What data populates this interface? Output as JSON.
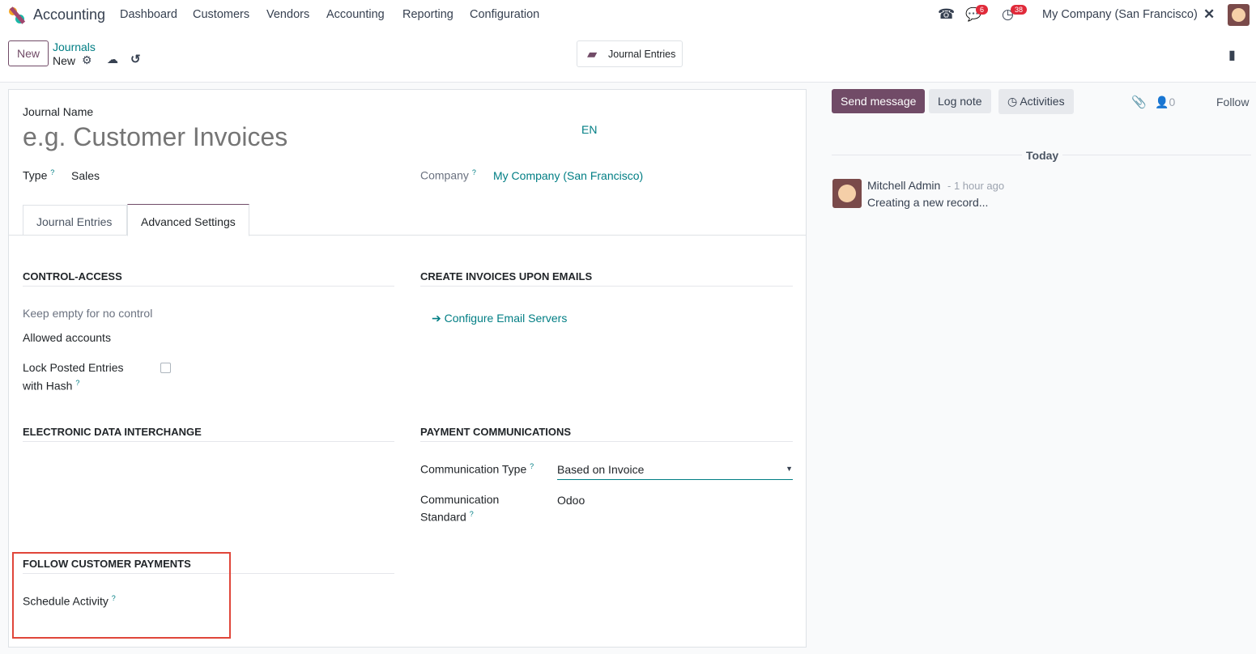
{
  "nav": {
    "app": "Accounting",
    "menu": [
      "Dashboard",
      "Customers",
      "Vendors",
      "Accounting",
      "Reporting",
      "Configuration"
    ],
    "msg_count": "6",
    "activity_count": "38",
    "company": "My Company (San Francisco)"
  },
  "control": {
    "new": "New",
    "breadcrumb": "Journals",
    "record": "New",
    "smart_button": "Journal Entries"
  },
  "form": {
    "journal_name_label": "Journal Name",
    "journal_name_placeholder": "e.g. Customer Invoices",
    "lang": "EN",
    "type_label": "Type",
    "type_value": "Sales",
    "company_label": "Company",
    "company_value": "My Company (San Francisco)",
    "tabs": [
      "Journal Entries",
      "Advanced Settings"
    ],
    "control_access": "CONTROL-ACCESS",
    "keep_empty": "Keep empty for no control",
    "allowed_accounts": "Allowed accounts",
    "lock_posted_1": "Lock Posted Entries",
    "lock_posted_2": "with Hash",
    "create_invoices": "CREATE INVOICES UPON EMAILS",
    "configure_email": "Configure Email Servers",
    "edi": "ELECTRONIC DATA INTERCHANGE",
    "payment_comm": "PAYMENT COMMUNICATIONS",
    "comm_type_label": "Communication Type",
    "comm_type_value": "Based on Invoice",
    "comm_std_1": "Communication",
    "comm_std_2": "Standard",
    "comm_std_value": "Odoo",
    "follow_payments": "FOLLOW CUSTOMER PAYMENTS",
    "schedule_activity": "Schedule Activity"
  },
  "chatter": {
    "send": "Send message",
    "log": "Log note",
    "activities": "Activities",
    "followers": "0",
    "follow": "Follow",
    "today": "Today",
    "author": "Mitchell Admin",
    "time": "- 1 hour ago",
    "body": "Creating a new record..."
  }
}
